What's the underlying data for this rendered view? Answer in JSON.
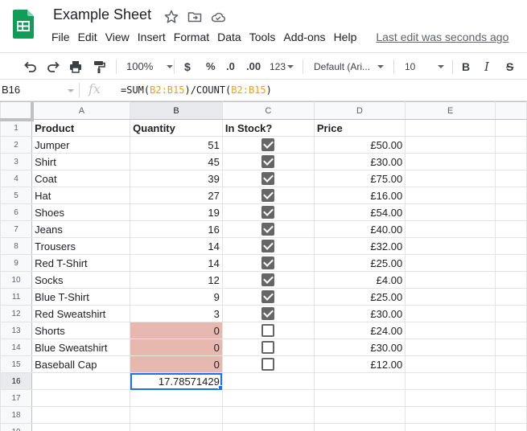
{
  "app": {
    "doc_title": "Example Sheet"
  },
  "menu": {
    "items": [
      "File",
      "Edit",
      "View",
      "Insert",
      "Format",
      "Data",
      "Tools",
      "Add-ons",
      "Help"
    ],
    "last_edit": "Last edit was seconds ago"
  },
  "toolbar": {
    "zoom": "100%",
    "currency": "$",
    "percent": "%",
    "decrease_decimals": ".0",
    "increase_decimals": ".00",
    "more_formats": "123",
    "font": "Default (Ari...",
    "font_size": "10",
    "bold": "B",
    "italic": "I",
    "strikethrough": "S"
  },
  "formula_bar": {
    "name_box": "B16",
    "fx": "fx",
    "formula_parts": [
      "=SUM(",
      "B2:B15",
      ")/COUNT(",
      "B2:B15",
      ")"
    ]
  },
  "grid": {
    "columns": [
      "A",
      "B",
      "C",
      "D",
      "E"
    ],
    "selected_column": "B",
    "selected_row": 16,
    "rows": [
      {
        "num": "1",
        "a": "Product",
        "b": "Quantity",
        "c": "In Stock?",
        "d": "Price",
        "header": true
      },
      {
        "num": "2",
        "a": "Jumper",
        "b": "51",
        "checked": true,
        "d": "£50.00"
      },
      {
        "num": "3",
        "a": "Shirt",
        "b": "45",
        "checked": true,
        "d": "£30.00"
      },
      {
        "num": "4",
        "a": "Coat",
        "b": "39",
        "checked": true,
        "d": "£75.00"
      },
      {
        "num": "5",
        "a": "Hat",
        "b": "27",
        "checked": true,
        "d": "£16.00"
      },
      {
        "num": "6",
        "a": "Shoes",
        "b": "19",
        "checked": true,
        "d": "£54.00"
      },
      {
        "num": "7",
        "a": "Jeans",
        "b": "16",
        "checked": true,
        "d": "£40.00"
      },
      {
        "num": "8",
        "a": "Trousers",
        "b": "14",
        "checked": true,
        "d": "£32.00"
      },
      {
        "num": "9",
        "a": "Red T-Shirt",
        "b": "14",
        "checked": true,
        "d": "£25.00"
      },
      {
        "num": "10",
        "a": "Socks",
        "b": "12",
        "checked": true,
        "d": "£4.00"
      },
      {
        "num": "11",
        "a": "Blue T-Shirt",
        "b": "9",
        "checked": true,
        "d": "£25.00"
      },
      {
        "num": "12",
        "a": "Red Sweatshirt",
        "b": "3",
        "checked": true,
        "d": "£30.00"
      },
      {
        "num": "13",
        "a": "Shorts",
        "b": "0",
        "checked": false,
        "d": "£24.00"
      },
      {
        "num": "14",
        "a": "Blue Sweatshirt",
        "b": "0",
        "checked": false,
        "d": "£30.00"
      },
      {
        "num": "15",
        "a": "Baseball Cap",
        "b": "0",
        "checked": false,
        "d": "£12.00"
      },
      {
        "num": "16",
        "a": "",
        "b": "17.78571429",
        "d": ""
      },
      {
        "num": "17",
        "a": "",
        "b": "",
        "d": ""
      },
      {
        "num": "18",
        "a": "",
        "b": "",
        "d": ""
      },
      {
        "num": "19",
        "a": "",
        "b": "",
        "d": ""
      }
    ]
  },
  "colors": {
    "zero_fill": "#e6b8af",
    "selection": "#1a73e8",
    "checkbox": "#666666",
    "logo_green": "#0f9d58",
    "formula_ref": "#e8a317"
  }
}
